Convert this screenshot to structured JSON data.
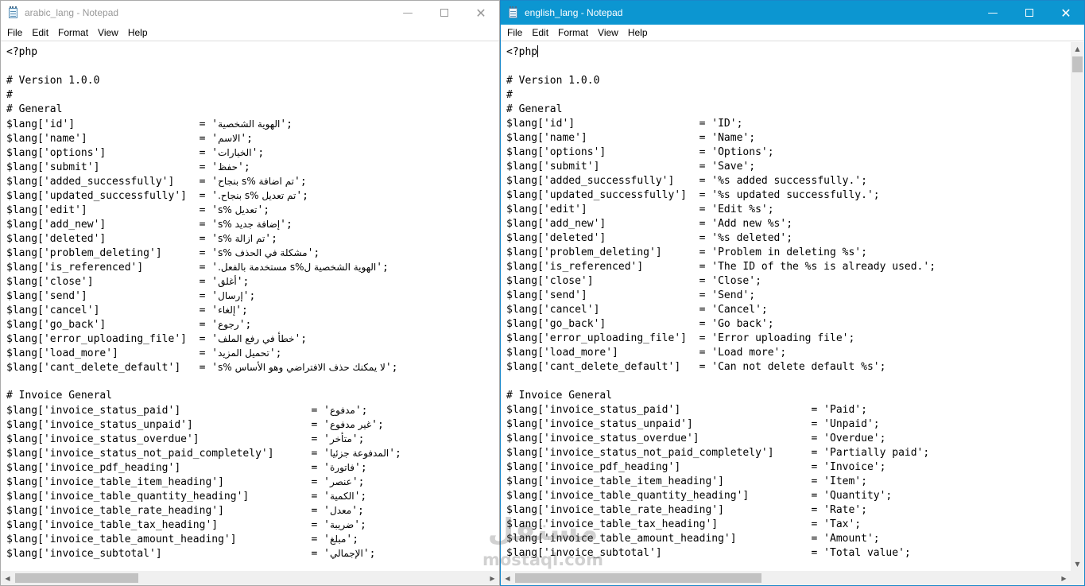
{
  "watermark": {
    "logo": "مستقل",
    "text": "mostaql.com"
  },
  "windows": [
    {
      "id": "left",
      "title": "arabic_lang - Notepad",
      "menu": [
        "File",
        "Edit",
        "Format",
        "View",
        "Help"
      ],
      "lines": [
        "<?php",
        "",
        "# Version 1.0.0",
        "#",
        "# General",
        {
          "pre": "$lang['id']                    = '",
          "ar": "الهوية الشخصية",
          "post": "';"
        },
        {
          "pre": "$lang['name']                  = '",
          "ar": "الاسم",
          "post": "';"
        },
        {
          "pre": "$lang['options']               = '",
          "ar": "الخيارات",
          "post": "';"
        },
        {
          "pre": "$lang['submit']                = '",
          "ar": "حفظ",
          "post": "';"
        },
        {
          "pre": "$lang['added_successfully']    = '",
          "ar": "تم اضافة %s بنجاح",
          "post": "';"
        },
        {
          "pre": "$lang['updated_successfully']  = '",
          "ar": "تم تعديل %s بنجاح.",
          "post": "';"
        },
        {
          "pre": "$lang['edit']                  = '",
          "ar": "تعديل %s",
          "post": "';"
        },
        {
          "pre": "$lang['add_new']               = '",
          "ar": "إضافة جديد %s",
          "post": "';"
        },
        {
          "pre": "$lang['deleted']               = '",
          "ar": "تم ازالة %s",
          "post": "';"
        },
        {
          "pre": "$lang['problem_deleting']      = '",
          "ar": "مشكلة في الحذف %s",
          "post": "';"
        },
        {
          "pre": "$lang['is_referenced']         = '",
          "ar": "الهوية الشخصية ل%s مستخدمة بالفعل.",
          "post": "';"
        },
        {
          "pre": "$lang['close']                 = '",
          "ar": "أغلق",
          "post": "';"
        },
        {
          "pre": "$lang['send']                  = '",
          "ar": "إرسال",
          "post": "';"
        },
        {
          "pre": "$lang['cancel']                = '",
          "ar": "إلغاء",
          "post": "';"
        },
        {
          "pre": "$lang['go_back']               = '",
          "ar": "رجوع",
          "post": "';"
        },
        {
          "pre": "$lang['error_uploading_file']  = '",
          "ar": "خطأ في رفع الملف",
          "post": "';"
        },
        {
          "pre": "$lang['load_more']             = '",
          "ar": "تحميل المزيد",
          "post": "';"
        },
        {
          "pre": "$lang['cant_delete_default']   = '",
          "ar": "لا يمكنك حذف الافتراضي وهو الأساس %s",
          "post": "';"
        },
        "",
        "# Invoice General",
        {
          "pre": "$lang['invoice_status_paid']                     = '",
          "ar": "مدفوع",
          "post": "';"
        },
        {
          "pre": "$lang['invoice_status_unpaid']                   = '",
          "ar": "غير مدفوع",
          "post": "';"
        },
        {
          "pre": "$lang['invoice_status_overdue']                  = '",
          "ar": "متأخر",
          "post": "';"
        },
        {
          "pre": "$lang['invoice_status_not_paid_completely']      = '",
          "ar": "المدفوعة جزئيا",
          "post": "';"
        },
        {
          "pre": "$lang['invoice_pdf_heading']                     = '",
          "ar": "فاتورة",
          "post": "';"
        },
        {
          "pre": "$lang['invoice_table_item_heading']              = '",
          "ar": "عنصر",
          "post": "';"
        },
        {
          "pre": "$lang['invoice_table_quantity_heading']          = '",
          "ar": "الكمية",
          "post": "';"
        },
        {
          "pre": "$lang['invoice_table_rate_heading']              = '",
          "ar": "معدل",
          "post": "';"
        },
        {
          "pre": "$lang['invoice_table_tax_heading']               = '",
          "ar": "ضريبة",
          "post": "';"
        },
        {
          "pre": "$lang['invoice_table_amount_heading']            = '",
          "ar": "مبلغ",
          "post": "';"
        },
        {
          "pre": "$lang['invoice_subtotal']                        = '",
          "ar": "الإجمالي",
          "post": "';"
        }
      ]
    },
    {
      "id": "right",
      "title": "english_lang - Notepad",
      "menu": [
        "File",
        "Edit",
        "Format",
        "View",
        "Help"
      ],
      "lines": [
        "<?php",
        "",
        "# Version 1.0.0",
        "#",
        "# General",
        "$lang['id']                    = 'ID';",
        "$lang['name']                  = 'Name';",
        "$lang['options']               = 'Options';",
        "$lang['submit']                = 'Save';",
        "$lang['added_successfully']    = '%s added successfully.';",
        "$lang['updated_successfully']  = '%s updated successfully.';",
        "$lang['edit']                  = 'Edit %s';",
        "$lang['add_new']               = 'Add new %s';",
        "$lang['deleted']               = '%s deleted';",
        "$lang['problem_deleting']      = 'Problem in deleting %s';",
        "$lang['is_referenced']         = 'The ID of the %s is already used.';",
        "$lang['close']                 = 'Close';",
        "$lang['send']                  = 'Send';",
        "$lang['cancel']                = 'Cancel';",
        "$lang['go_back']               = 'Go back';",
        "$lang['error_uploading_file']  = 'Error uploading file';",
        "$lang['load_more']             = 'Load more';",
        "$lang['cant_delete_default']   = 'Can not delete default %s';",
        "",
        "# Invoice General",
        "$lang['invoice_status_paid']                     = 'Paid';",
        "$lang['invoice_status_unpaid']                   = 'Unpaid';",
        "$lang['invoice_status_overdue']                  = 'Overdue';",
        "$lang['invoice_status_not_paid_completely']      = 'Partially paid';",
        "$lang['invoice_pdf_heading']                     = 'Invoice';",
        "$lang['invoice_table_item_heading']              = 'Item';",
        "$lang['invoice_table_quantity_heading']          = 'Quantity';",
        "$lang['invoice_table_rate_heading']              = 'Rate';",
        "$lang['invoice_table_tax_heading']               = 'Tax';",
        "$lang['invoice_table_amount_heading']            = 'Amount';",
        "$lang['invoice_subtotal']                        = 'Total value';"
      ]
    }
  ]
}
